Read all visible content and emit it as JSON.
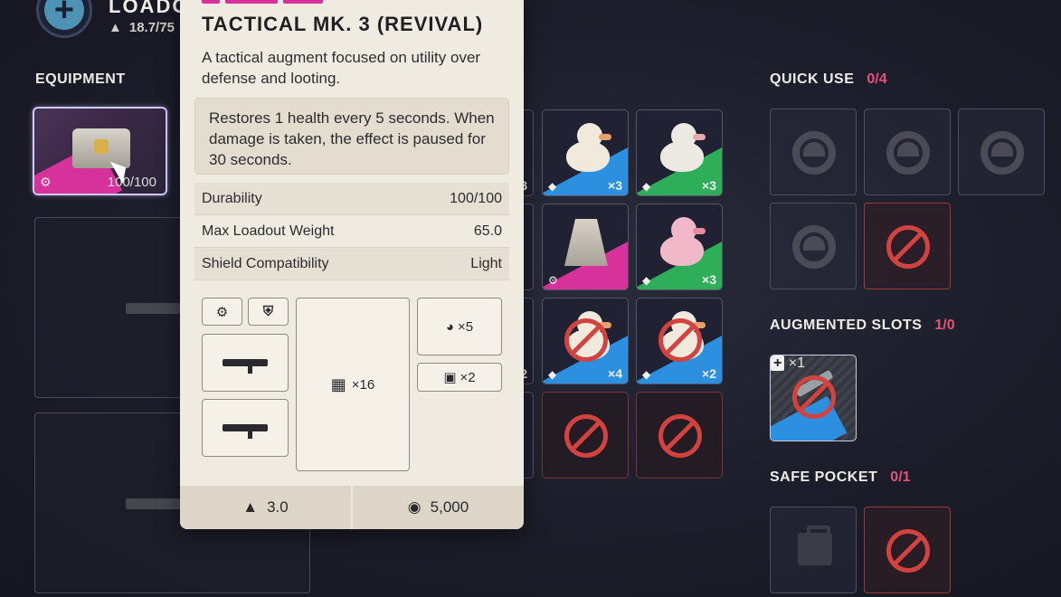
{
  "header": {
    "loadout_title": "LOADO",
    "weight": "18.7/75",
    "plus_icon": "plus-icon"
  },
  "equipment": {
    "label": "EQUIPMENT",
    "augment_durability": "100/100"
  },
  "backpack": {
    "counts": [
      "×3",
      "×3",
      "×3",
      "×4",
      "×2",
      "3",
      "2"
    ]
  },
  "quick_use": {
    "label": "QUICK USE",
    "count": "0/4"
  },
  "augmented_slots": {
    "label": "AUGMENTED SLOTS",
    "count": "1/0",
    "item_count": "×1"
  },
  "safe_pocket": {
    "label": "SAFE POCKET",
    "count": "0/1"
  },
  "tooltip": {
    "title": "TACTICAL MK. 3 (REVIVAL)",
    "description": "A tactical augment focused on utility over defense and looting.",
    "effect": "Restores 1 health every 5 seconds. When damage is taken, the effect is paused for 30 seconds.",
    "stats": [
      {
        "label": "Durability",
        "value": "100/100"
      },
      {
        "label": "Max Loadout Weight",
        "value": "65.0"
      },
      {
        "label": "Shield Compatibility",
        "value": "Light"
      }
    ],
    "slots": {
      "backpack": "×16",
      "quick_use": "×5",
      "safe_pocket": "×2"
    },
    "weight": "3.0",
    "price": "5,000"
  },
  "colors": {
    "accent_pink": "#e2537a",
    "rarity_blue": "#2d8fe0",
    "rarity_green": "#2fae5a",
    "rarity_magenta": "#d7329c",
    "blocked_red": "#d2433f",
    "card_bg": "#f0ebe1"
  }
}
